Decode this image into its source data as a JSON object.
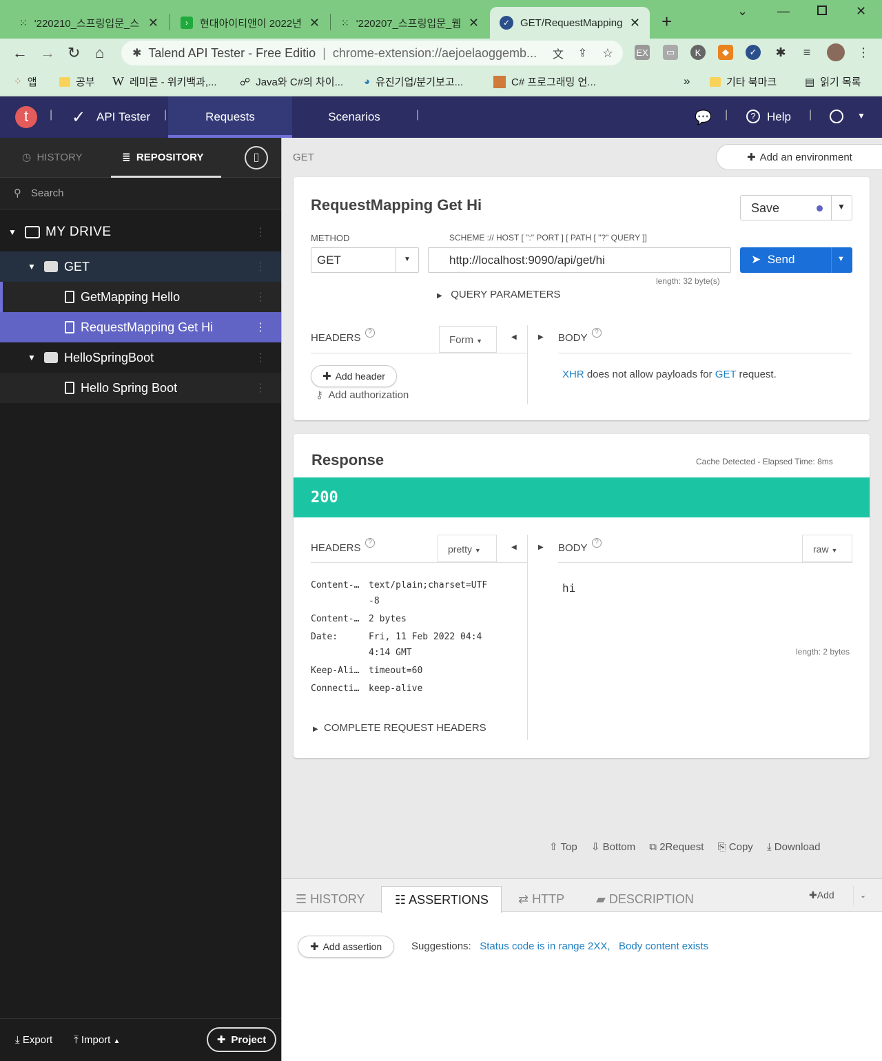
{
  "browser": {
    "tabs": [
      {
        "title": "'220210_스프링입문_스",
        "icon": "github-icon"
      },
      {
        "title": "현대아이티앤이 2022년",
        "icon": "green-s-icon"
      },
      {
        "title": "'220207_스프링입문_웹",
        "icon": "github-icon"
      },
      {
        "title": "GET/RequestMapping",
        "icon": "talend-check-icon"
      }
    ],
    "new_tab": "+",
    "address_prefix": "Talend API Tester - Free Editio",
    "address_url": "chrome-extension://aejoelaoggemb...",
    "bookmarks": [
      {
        "label": "앱",
        "icon": "apps-grid-icon"
      },
      {
        "label": "공부",
        "icon": "folder-icon"
      },
      {
        "label": "레미콘 - 위키백과,...",
        "icon": "wikipedia-icon"
      },
      {
        "label": "Java와 C#의 차이...",
        "icon": "link-icon"
      },
      {
        "label": "유진기업/분기보고...",
        "icon": "globe-icon"
      },
      {
        "label": "C# 프로그래밍 언...",
        "icon": "image-icon"
      }
    ],
    "bookmarks_more": "»",
    "other_bookmarks": "기타 북마크",
    "reading_list": "읽기 목록"
  },
  "app": {
    "logo_letter": "t",
    "title": "API Tester",
    "nav": [
      "Requests",
      "Scenarios"
    ],
    "help": "Help"
  },
  "sidebar": {
    "tabs": {
      "history": "HISTORY",
      "repository": "REPOSITORY"
    },
    "search_placeholder": "Search",
    "drive": "MY DRIVE",
    "tree": [
      {
        "label": "GET",
        "type": "service"
      },
      {
        "label": "GetMapping Hello",
        "type": "request"
      },
      {
        "label": "RequestMapping Get Hi",
        "type": "request",
        "selected": true
      },
      {
        "label": "HelloSpringBoot",
        "type": "service"
      },
      {
        "label": "Hello Spring Boot",
        "type": "request"
      }
    ],
    "footer": {
      "export": "Export",
      "import": "Import",
      "project": "Project"
    }
  },
  "request": {
    "breadcrumb": "GET",
    "add_env": "Add an environment",
    "name": "RequestMapping Get Hi",
    "save": "Save",
    "method_label": "METHOD",
    "method": "GET",
    "url_label": "SCHEME :// HOST [ \":\" PORT ] [ PATH [ \"?\" QUERY ]]",
    "url": "http://localhost:9090/api/get/hi",
    "url_length": "length: 32 byte(s)",
    "send": "Send",
    "query_params": "QUERY PARAMETERS",
    "headers": "HEADERS",
    "headers_mode": "Form",
    "body": "BODY",
    "add_header": "Add header",
    "add_auth": "Add authorization",
    "body_msg_xhr": "XHR",
    "body_msg_mid": "does not allow payloads for",
    "body_msg_get": "GET",
    "body_msg_end": "request."
  },
  "response": {
    "title": "Response",
    "meta": "Cache Detected - Elapsed Time: 8ms",
    "status": "200",
    "status_color": "#1bc4a3",
    "headers": "HEADERS",
    "headers_mode": "pretty",
    "body": "BODY",
    "body_mode": "raw",
    "header_rows": [
      {
        "k": "Content-…",
        "v1": "text/plain;charset=UTF",
        "v2": "-8"
      },
      {
        "k": "Content-…",
        "v1": "2 bytes",
        "v2": ""
      },
      {
        "k": "Date:",
        "v1": "Fri, 11 Feb 2022 04:4",
        "v2": "4:14 GMT"
      },
      {
        "k": "Keep-Ali…",
        "v1": "timeout=60",
        "v2": ""
      },
      {
        "k": "Connecti…",
        "v1": "keep-alive",
        "v2": ""
      }
    ],
    "complete_headers": "COMPLETE REQUEST HEADERS",
    "body_text": "hi",
    "body_length": "length: 2 bytes"
  },
  "actions": [
    "Top",
    "Bottom",
    "2Request",
    "Copy",
    "Download"
  ],
  "bottom": {
    "tabs": [
      "HISTORY",
      "ASSERTIONS",
      "HTTP",
      "DESCRIPTION"
    ],
    "add": "Add",
    "add_assertion": "Add assertion",
    "suggestions": "Suggestions:",
    "suggest1": "Status code is in range 2XX,",
    "suggest2": "Body content exists"
  }
}
